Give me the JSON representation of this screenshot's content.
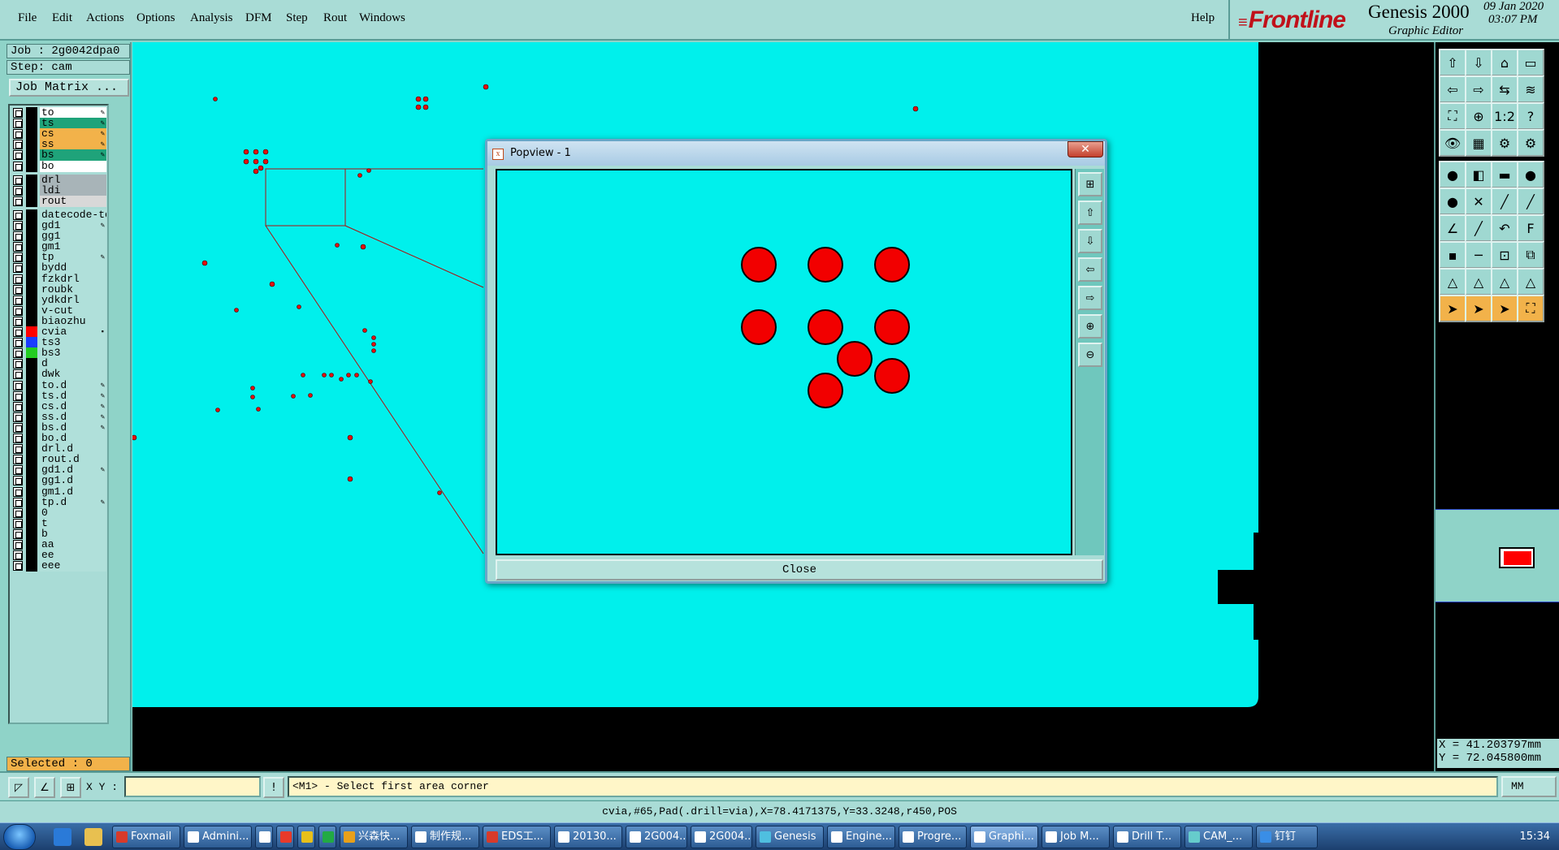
{
  "menubar": {
    "items": [
      "File",
      "Edit",
      "Actions",
      "Options",
      "Analysis",
      "DFM",
      "Step",
      "Rout",
      "Windows"
    ],
    "help": "Help"
  },
  "brand": {
    "logo": "Frontline",
    "product": "Genesis 2000",
    "subtitle": "Graphic Editor",
    "date": "09 Jan 2020",
    "time": "03:07 PM"
  },
  "job": {
    "job_line": "Job : 2g0042dpa0",
    "step_line": "Step: cam",
    "matrix_button": "Job Matrix ..."
  },
  "layers": [
    {
      "name": "to",
      "color": "#ffffff",
      "swatch": "#000000",
      "mark": "✎"
    },
    {
      "name": "ts",
      "color": "#1fa37a",
      "swatch": "#000000",
      "mark": "✎"
    },
    {
      "name": "cs",
      "color": "#f2b24a",
      "swatch": "#000000",
      "mark": "✎"
    },
    {
      "name": "ss",
      "color": "#f2b24a",
      "swatch": "#000000",
      "mark": "✎"
    },
    {
      "name": "bs",
      "color": "#1fa37a",
      "swatch": "#000000",
      "mark": "✎"
    },
    {
      "name": "bo",
      "color": "#ffffff",
      "swatch": "#000000",
      "mark": ""
    },
    {
      "name": "drl",
      "color": "#a8b4b8",
      "swatch": "#000000",
      "mark": ""
    },
    {
      "name": "ldi",
      "color": "#a8b4b8",
      "swatch": "#000000",
      "mark": ""
    },
    {
      "name": "rout",
      "color": "#d8d8d8",
      "swatch": "#000000",
      "mark": ""
    },
    {
      "name": "datecode-to",
      "color": "#b0e0da",
      "swatch": "#000000",
      "mark": ""
    },
    {
      "name": "gd1",
      "color": "#b0e0da",
      "swatch": "#000000",
      "mark": "✎"
    },
    {
      "name": "gg1",
      "color": "#b0e0da",
      "swatch": "#000000",
      "mark": ""
    },
    {
      "name": "gm1",
      "color": "#b0e0da",
      "swatch": "#000000",
      "mark": ""
    },
    {
      "name": "tp",
      "color": "#b0e0da",
      "swatch": "#000000",
      "mark": "✎"
    },
    {
      "name": "bydd",
      "color": "#b0e0da",
      "swatch": "#000000",
      "mark": ""
    },
    {
      "name": "fzkdrl",
      "color": "#b0e0da",
      "swatch": "#000000",
      "mark": ""
    },
    {
      "name": "roubk",
      "color": "#b0e0da",
      "swatch": "#000000",
      "mark": ""
    },
    {
      "name": "ydkdrl",
      "color": "#b0e0da",
      "swatch": "#000000",
      "mark": ""
    },
    {
      "name": "v-cut",
      "color": "#b0e0da",
      "swatch": "#000000",
      "mark": ""
    },
    {
      "name": "biaozhu",
      "color": "#b0e0da",
      "swatch": "#000000",
      "mark": ""
    },
    {
      "name": "cvia",
      "color": "#b0e0da",
      "swatch": "#ff0000",
      "mark": "▪"
    },
    {
      "name": "ts3",
      "color": "#b0e0da",
      "swatch": "#1a3cff",
      "mark": ""
    },
    {
      "name": "bs3",
      "color": "#b0e0da",
      "swatch": "#22cc22",
      "mark": ""
    },
    {
      "name": "d",
      "color": "#b0e0da",
      "swatch": "#000000",
      "mark": ""
    },
    {
      "name": "dwk",
      "color": "#b0e0da",
      "swatch": "#000000",
      "mark": ""
    },
    {
      "name": "to.d",
      "color": "#b0e0da",
      "swatch": "#000000",
      "mark": "✎"
    },
    {
      "name": "ts.d",
      "color": "#b0e0da",
      "swatch": "#000000",
      "mark": "✎"
    },
    {
      "name": "cs.d",
      "color": "#b0e0da",
      "swatch": "#000000",
      "mark": "✎"
    },
    {
      "name": "ss.d",
      "color": "#b0e0da",
      "swatch": "#000000",
      "mark": "✎"
    },
    {
      "name": "bs.d",
      "color": "#b0e0da",
      "swatch": "#000000",
      "mark": "✎"
    },
    {
      "name": "bo.d",
      "color": "#b0e0da",
      "swatch": "#000000",
      "mark": ""
    },
    {
      "name": "drl.d",
      "color": "#b0e0da",
      "swatch": "#000000",
      "mark": ""
    },
    {
      "name": "rout.d",
      "color": "#b0e0da",
      "swatch": "#000000",
      "mark": ""
    },
    {
      "name": "gd1.d",
      "color": "#b0e0da",
      "swatch": "#000000",
      "mark": "✎"
    },
    {
      "name": "gg1.d",
      "color": "#b0e0da",
      "swatch": "#000000",
      "mark": ""
    },
    {
      "name": "gm1.d",
      "color": "#b0e0da",
      "swatch": "#000000",
      "mark": ""
    },
    {
      "name": "tp.d",
      "color": "#b0e0da",
      "swatch": "#000000",
      "mark": "✎"
    },
    {
      "name": "0",
      "color": "#b0e0da",
      "swatch": "#000000",
      "mark": ""
    },
    {
      "name": "t",
      "color": "#b0e0da",
      "swatch": "#000000",
      "mark": ""
    },
    {
      "name": "b",
      "color": "#b0e0da",
      "swatch": "#000000",
      "mark": ""
    },
    {
      "name": "aa",
      "color": "#b0e0da",
      "swatch": "#000000",
      "mark": ""
    },
    {
      "name": "ee",
      "color": "#b0e0da",
      "swatch": "#000000",
      "mark": ""
    },
    {
      "name": "eee",
      "color": "#b0e0da",
      "swatch": "#000000",
      "mark": ""
    }
  ],
  "selected": "Selected : 0",
  "canvas": {
    "board_color": "#00f0ec",
    "pad_color": "#e01010"
  },
  "popview": {
    "title": "Popview - 1",
    "close_label": "Close",
    "close_x": "✕",
    "background": "#00f0ec",
    "pad_color": "#f20000"
  },
  "right_toolbar": {
    "coords_x": "X = 41.203797mm",
    "coords_y": "Y = 72.045800mm"
  },
  "status": {
    "xy_label": "X Y :",
    "xy_value": "",
    "prompt": "<M1> - Select first area corner",
    "unit": "MM",
    "info": "cvia,#65,Pad(.drill=via),X=78.4171375,Y=33.3248,r450,POS"
  },
  "taskbar": {
    "tasks": [
      {
        "label": "Foxmail",
        "icon": "#d83a2a"
      },
      {
        "label": "Admini...",
        "icon": "#ffffff"
      },
      {
        "label": "",
        "icon": "#ffffff"
      },
      {
        "label": "",
        "icon": "#e83a2a"
      },
      {
        "label": "",
        "icon": "#e8c01a"
      },
      {
        "label": "",
        "icon": "#22aa44"
      },
      {
        "label": "兴森快...",
        "icon": "#e8a01a"
      },
      {
        "label": "制作规...",
        "icon": "#ffffff"
      },
      {
        "label": "EDS工...",
        "icon": "#d83a2a"
      },
      {
        "label": "20130...",
        "icon": "#ffffff"
      },
      {
        "label": "2G004...",
        "icon": "#ffffff"
      },
      {
        "label": "2G004...",
        "icon": "#ffffff"
      },
      {
        "label": "Genesis",
        "icon": "#4fbfe0"
      },
      {
        "label": "Engine...",
        "icon": "#ffffff"
      },
      {
        "label": "Progre...",
        "icon": "#ffffff"
      },
      {
        "label": "Graphi...",
        "icon": "#ffffff"
      },
      {
        "label": "Job M...",
        "icon": "#ffffff"
      },
      {
        "label": "Drill T...",
        "icon": "#ffffff"
      },
      {
        "label": "CAM_...",
        "icon": "#66cccc"
      },
      {
        "label": "钉钉",
        "icon": "#3a8ee6"
      }
    ],
    "clock": "15:34"
  }
}
